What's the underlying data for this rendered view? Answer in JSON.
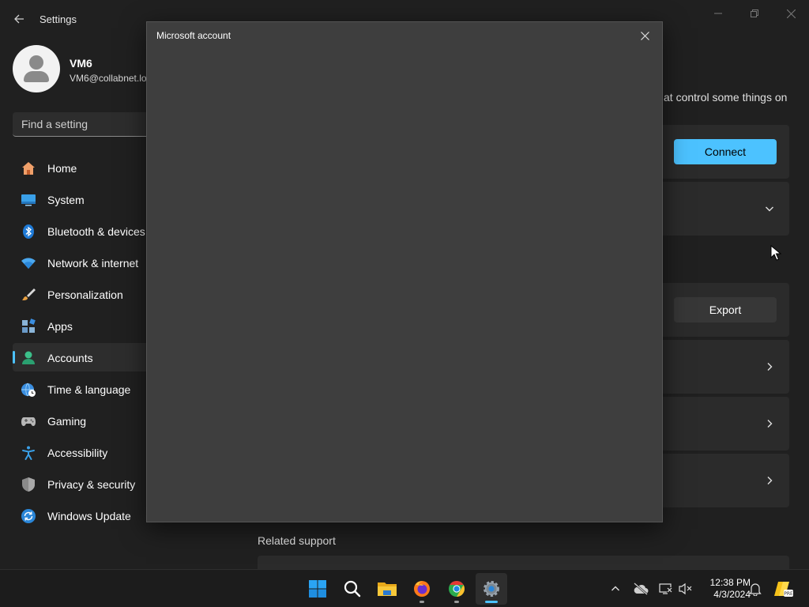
{
  "window": {
    "app_title": "Settings"
  },
  "profile": {
    "name": "VM6",
    "email": "VM6@collabnet.lo"
  },
  "search": {
    "placeholder": "Find a setting"
  },
  "sidebar": {
    "items": [
      {
        "label": "Home",
        "icon": "home-icon"
      },
      {
        "label": "System",
        "icon": "system-icon"
      },
      {
        "label": "Bluetooth & devices",
        "icon": "bluetooth-icon"
      },
      {
        "label": "Network & internet",
        "icon": "wifi-icon"
      },
      {
        "label": "Personalization",
        "icon": "brush-icon"
      },
      {
        "label": "Apps",
        "icon": "apps-icon"
      },
      {
        "label": "Accounts",
        "icon": "accounts-icon",
        "selected": true
      },
      {
        "label": "Time & language",
        "icon": "globe-clock-icon"
      },
      {
        "label": "Gaming",
        "icon": "gamepad-icon"
      },
      {
        "label": "Accessibility",
        "icon": "accessibility-icon"
      },
      {
        "label": "Privacy & security",
        "icon": "shield-icon"
      },
      {
        "label": "Windows Update",
        "icon": "update-icon"
      }
    ]
  },
  "content": {
    "partial_text": "at control some things on",
    "connect_label": "Connect",
    "export_label": "Export",
    "related_support": "Related support"
  },
  "dialog": {
    "title": "Microsoft account"
  },
  "taskbar": {
    "time": "12:38 PM",
    "date": "4/3/2024"
  },
  "colors": {
    "accent": "#4cc2ff",
    "background": "#202020",
    "dialog_bg": "#3e3e3e",
    "taskbar_bg": "#1c1c1c"
  }
}
